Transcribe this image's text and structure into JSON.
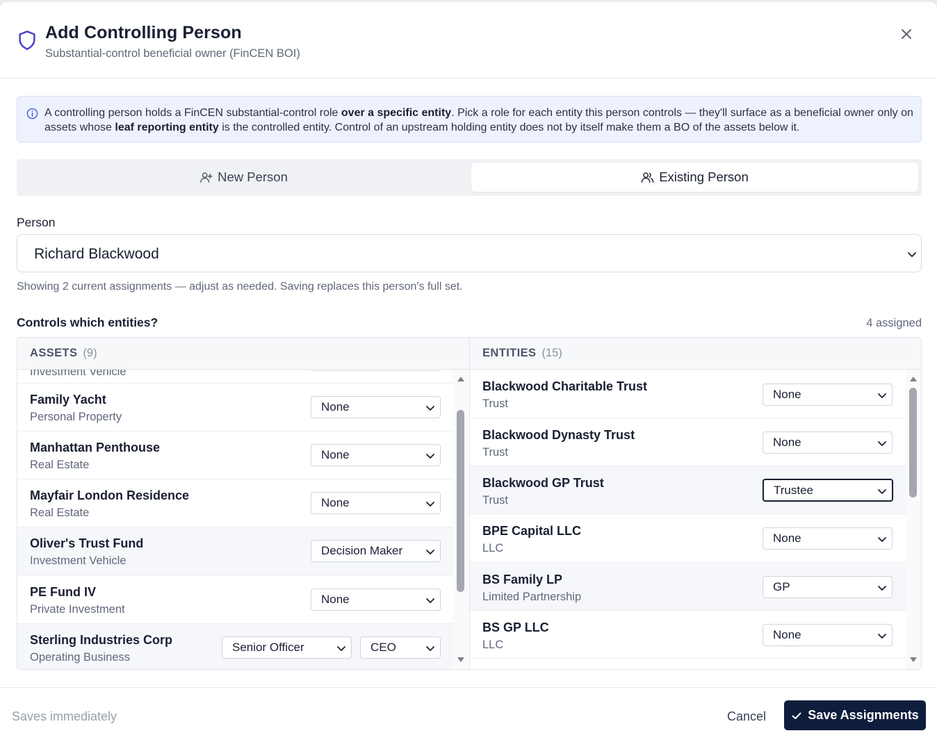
{
  "header": {
    "title": "Add Controlling Person",
    "subtitle": "Substantial-control beneficial owner (FinCEN BOI)"
  },
  "info": {
    "part1": "A controlling person holds a FinCEN substantial-control role ",
    "bold1": "over a specific entity",
    "part2": ". Pick a role for each entity this person controls — they'll surface as a beneficial owner only on assets whose ",
    "bold2": "leaf reporting entity",
    "part3": " is the controlled entity. Control of an upstream holding entity does not by itself make them a BO of the assets below it."
  },
  "tabs": {
    "new_person": "New Person",
    "existing_person": "Existing Person",
    "active": "existing_person"
  },
  "person": {
    "label": "Person",
    "selected": "Richard Blackwood",
    "hint": "Showing 2 current assignments — adjust as needed. Saving replaces this person's full set."
  },
  "controls": {
    "label": "Controls which entities?",
    "assigned": "4 assigned"
  },
  "assets": {
    "title": "ASSETS",
    "count": "(9)",
    "partial_row_type": "Investment Vehicle",
    "rows": [
      {
        "name": "Family Yacht",
        "type": "Personal Property",
        "role": "None"
      },
      {
        "name": "Manhattan Penthouse",
        "type": "Real Estate",
        "role": "None"
      },
      {
        "name": "Mayfair London Residence",
        "type": "Real Estate",
        "role": "None"
      },
      {
        "name": "Oliver's Trust Fund",
        "type": "Investment Vehicle",
        "role": "Decision Maker"
      },
      {
        "name": "PE Fund IV",
        "type": "Private Investment",
        "role": "None"
      },
      {
        "name": "Sterling Industries Corp",
        "type": "Operating Business",
        "role": "Senior Officer",
        "subrole": "CEO"
      }
    ]
  },
  "entities": {
    "title": "ENTITIES",
    "count": "(15)",
    "rows": [
      {
        "name": "Blackwood Charitable Trust",
        "type": "Trust",
        "role": "None"
      },
      {
        "name": "Blackwood Dynasty Trust",
        "type": "Trust",
        "role": "None"
      },
      {
        "name": "Blackwood GP Trust",
        "type": "Trust",
        "role": "Trustee"
      },
      {
        "name": "BPE Capital LLC",
        "type": "LLC",
        "role": "None"
      },
      {
        "name": "BS Family LP",
        "type": "Limited Partnership",
        "role": "GP"
      },
      {
        "name": "BS GP LLC",
        "type": "LLC",
        "role": "None"
      }
    ]
  },
  "footer": {
    "status": "Saves immediately",
    "cancel": "Cancel",
    "save": "Save Assignments"
  },
  "colors": {
    "accent": "#0f1d3d",
    "shield": "#4b47c9",
    "info_bg": "#eef2fd"
  }
}
